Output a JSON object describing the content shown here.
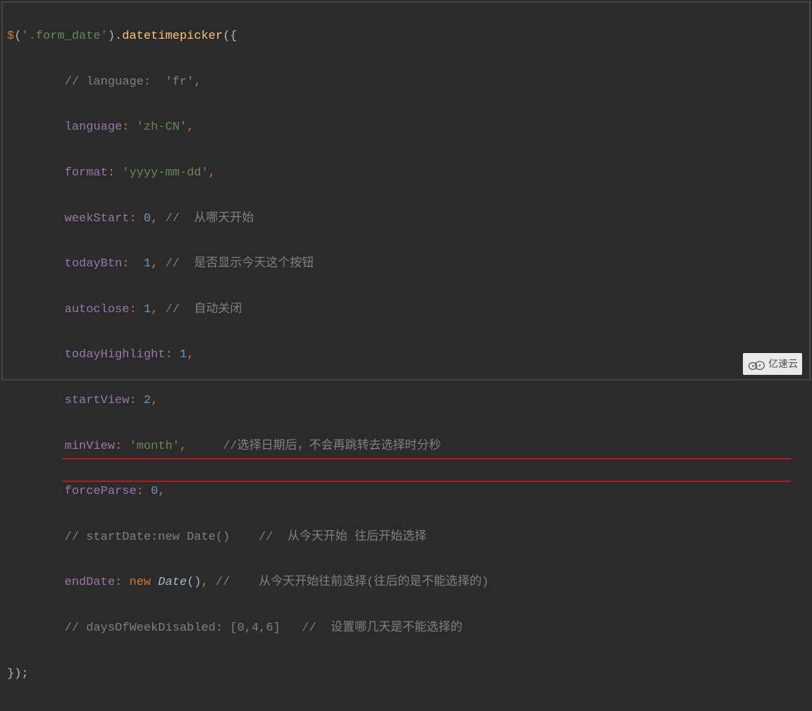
{
  "code": {
    "l0a": "$",
    "l0b": "(",
    "l0c": "'.form_date'",
    "l0d": ").",
    "l0e": "datetimepicker",
    "l0f": "({",
    "l1_indent": "        ",
    "l1_comment": "// language:  'fr',",
    "l2_indent": "        ",
    "l2_prop": "language",
    "l2_colon": ": ",
    "l2_val": "'zh-CN'",
    "l2_comma": ",",
    "l3_indent": "        ",
    "l3_prop": "format",
    "l3_colon": ": ",
    "l3_val": "'yyyy-mm-dd'",
    "l3_comma": ",",
    "l4_indent": "        ",
    "l4_prop": "weekStart",
    "l4_colon": ": ",
    "l4_val": "0",
    "l4_comma": ", ",
    "l4_comment": "//  从哪天开始",
    "l5_indent": "        ",
    "l5_prop": "todayBtn",
    "l5_colon": ":  ",
    "l5_val": "1",
    "l5_comma": ", ",
    "l5_comment": "//  是否显示今天这个按钮",
    "l6_indent": "        ",
    "l6_prop": "autoclose",
    "l6_colon": ": ",
    "l6_val": "1",
    "l6_comma": ", ",
    "l6_comment": "//  自动关闭",
    "l7_indent": "        ",
    "l7_prop": "todayHighlight",
    "l7_colon": ": ",
    "l7_val": "1",
    "l7_comma": ",",
    "l8_indent": "        ",
    "l8_prop": "startView",
    "l8_colon": ": ",
    "l8_val": "2",
    "l8_comma": ",",
    "l9_indent": "        ",
    "l9_prop": "minView",
    "l9_colon": ": ",
    "l9_val": "'month'",
    "l9_comma": ",     ",
    "l9_comment": "//选择日期后，不会再跳转去选择时分秒",
    "l10_indent": "        ",
    "l10_prop": "forceParse",
    "l10_colon": ": ",
    "l10_val": "0",
    "l10_comma": ",",
    "l11_indent": "        ",
    "l11_comment": "// startDate:new Date()    //  从今天开始 往后开始选择",
    "l12_indent": "        ",
    "l12_prop": "endDate",
    "l12_colon": ": ",
    "l12_new": "new",
    "l12_space": " ",
    "l12_class": "Date",
    "l12_paren": "()",
    "l12_comma": ", ",
    "l12_comment": "//    从今天开始往前选择(往后的是不能选择的)",
    "l13_indent": "        ",
    "l13_comment": "// daysOfWeekDisabled: [0,4,6]   //  设置哪几天是不能选择的",
    "l14": "});"
  },
  "watermark": {
    "text": "亿速云"
  }
}
